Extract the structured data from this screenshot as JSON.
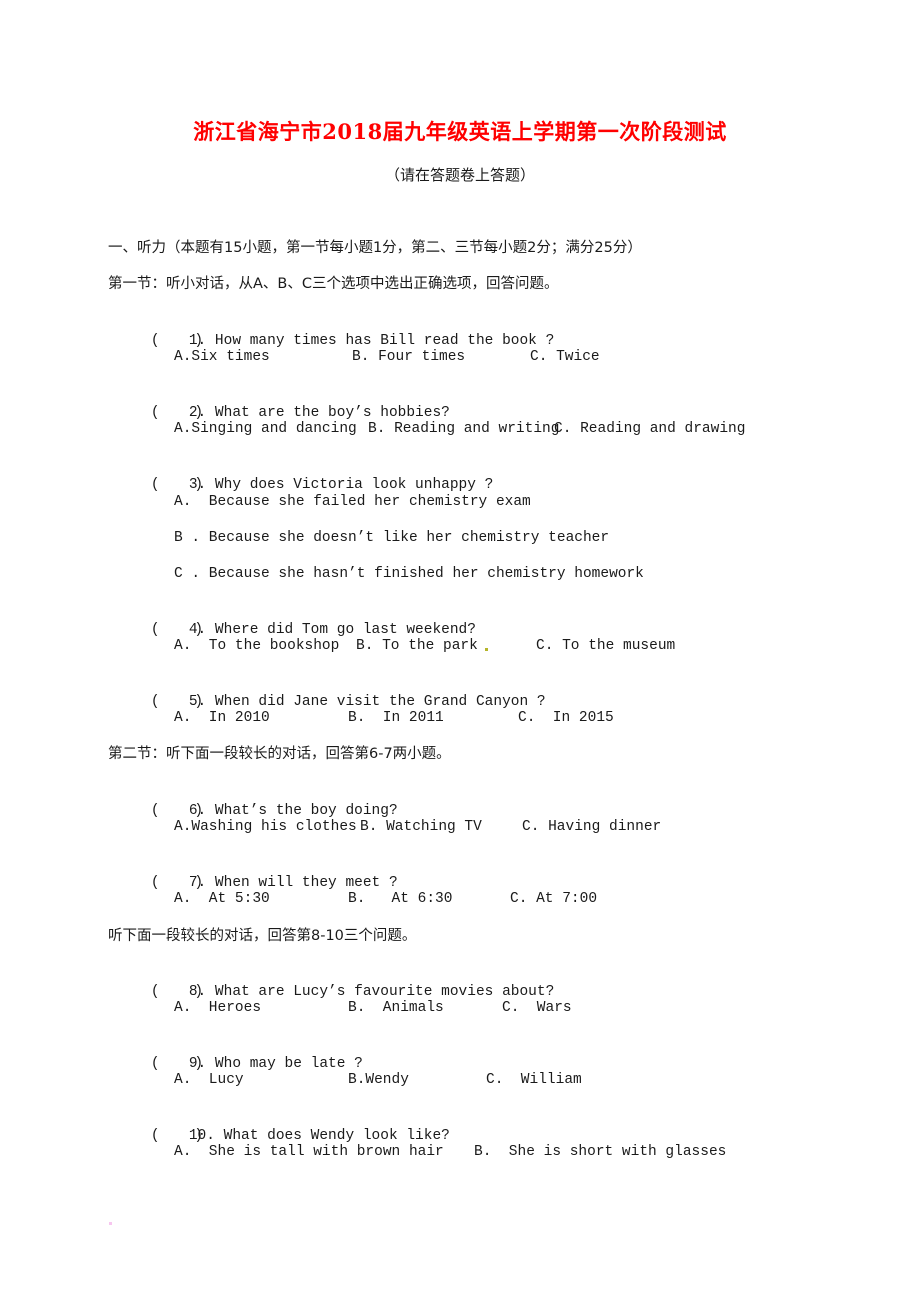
{
  "title": "浙江省海宁市2018届九年级英语上学期第一次阶段测试",
  "subtitle": "（请在答题卷上答题）",
  "part_one": {
    "heading": "一、听力（本题有15小题，第一节每小题1分，第二、三节每小题2分；满分25分）",
    "section_one_heading": "第一节：听小对话，从A、B、C三个选项中选出正确选项，回答问题。",
    "section_two_heading": "第二节：听下面一段较长的对话，回答第6-7两小题。",
    "section_three_heading": "听下面一段较长的对话，回答第8-10三个问题。"
  },
  "questions": [
    {
      "paren": "(    )",
      "number": "1.",
      "text": "How many times has Bill read the book ?",
      "options": [
        "A.Six times",
        "B. Four times",
        "C. Twice"
      ]
    },
    {
      "paren": "(    )",
      "number": "2.",
      "text": "What are the boy’s hobbies?",
      "options": [
        "A.Singing and dancing",
        "B. Reading and writing",
        "C. Reading and drawing"
      ]
    },
    {
      "paren": "(    )",
      "number": "3.",
      "text": "Why does Victoria look unhappy ?",
      "options": [
        "A.  Because she failed her chemistry exam",
        "B . Because she doesn’t like her chemistry teacher",
        "C . Because she hasn’t finished her chemistry homework"
      ]
    },
    {
      "paren": "(    )",
      "number": "4.",
      "text": "Where did Tom go last weekend?",
      "options": [
        "A.  To the bookshop",
        "B. To the park",
        "C. To the museum"
      ]
    },
    {
      "paren": "(    )",
      "number": "5.",
      "text": "When did Jane visit the Grand Canyon ?",
      "options": [
        "A.  In 2010",
        "B.  In 2011",
        "C.  In 2015"
      ]
    },
    {
      "paren": "(    )",
      "number": "6.",
      "text": "What’s the boy doing?",
      "options": [
        "A.Washing his clothes",
        "B. Watching TV",
        "C. Having dinner"
      ]
    },
    {
      "paren": "(    )",
      "number": "7.",
      "text": "When will they meet ?",
      "options": [
        "A.  At 5:30",
        "B.   At 6:30",
        "C. At 7:00"
      ]
    },
    {
      "paren": "(    )",
      "number": "8.",
      "text": "What are Lucy’s favourite movies about?",
      "options": [
        "A.  Heroes",
        "B.  Animals",
        "C.  Wars"
      ]
    },
    {
      "paren": "(    )",
      "number": "9.",
      "text": "Who may be late ?",
      "options": [
        "A.  Lucy",
        "B.Wendy",
        "C.  William"
      ]
    },
    {
      "paren": "(    )",
      "number": "10.",
      "text": "What does Wendy look like?",
      "options": [
        "A.  She is tall with brown hair",
        "B.  She is short with glasses"
      ]
    }
  ]
}
